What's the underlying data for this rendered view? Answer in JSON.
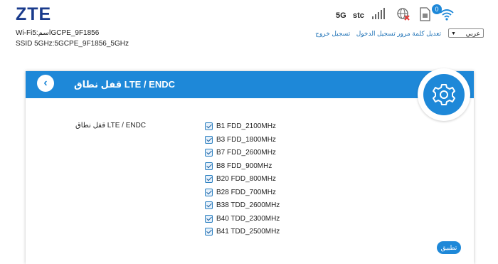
{
  "header": {
    "logo": "ZTE",
    "wifi_line": "Wi-Fi5:اسمGCPE_9F1856",
    "ssid_line": "SSID 5GHz:5GCPE_9F1856_5GHz",
    "network_type": "5G",
    "operator": "stc",
    "wifi_clients": "0",
    "language_selected": "عربي",
    "links": [
      "تعديل كلمة مرور تسجيل الدخول",
      "تسجيل خروج"
    ]
  },
  "panel": {
    "title": "قفل نطاق LTE / ENDC",
    "field_label": "قفل نطاق LTE / ENDC",
    "bands": [
      {
        "label": "B1 FDD_2100MHz",
        "checked": true
      },
      {
        "label": "B3 FDD_1800MHz",
        "checked": true
      },
      {
        "label": "B7 FDD_2600MHz",
        "checked": true
      },
      {
        "label": "B8 FDD_900MHz",
        "checked": true
      },
      {
        "label": "B20 FDD_800MHz",
        "checked": true
      },
      {
        "label": "B28 FDD_700MHz",
        "checked": true
      },
      {
        "label": "B38 TDD_2600MHz",
        "checked": true
      },
      {
        "label": "B40 TDD_2300MHz",
        "checked": true
      },
      {
        "label": "B41 TDD_2500MHz",
        "checked": true
      }
    ],
    "apply_label": "تطبيق"
  },
  "colors": {
    "accent": "#1e88d8",
    "logo": "#1a3b8c",
    "link": "#1a6fb5"
  }
}
